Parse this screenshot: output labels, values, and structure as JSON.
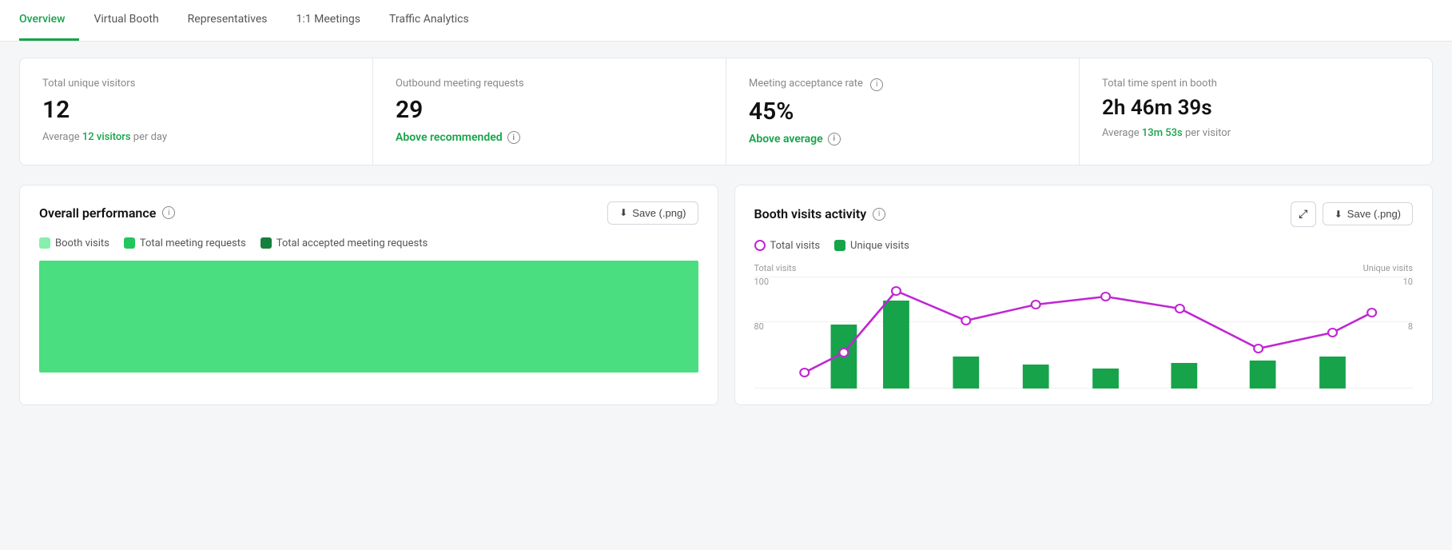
{
  "nav": {
    "items": [
      {
        "label": "Overview",
        "active": true
      },
      {
        "label": "Virtual Booth",
        "active": false
      },
      {
        "label": "Representatives",
        "active": false
      },
      {
        "label": "1:1 Meetings",
        "active": false
      },
      {
        "label": "Traffic Analytics",
        "active": false
      }
    ]
  },
  "stats": [
    {
      "label": "Total unique visitors",
      "value": "12",
      "sub_prefix": "Average ",
      "sub_highlight": "12 visitors",
      "sub_suffix": " per day"
    },
    {
      "label": "Outbound meeting requests",
      "value": "29",
      "badge": "Above recommended",
      "show_info": true
    },
    {
      "label": "Meeting acceptance rate",
      "value": "45%",
      "badge": "Above average",
      "show_info": true
    },
    {
      "label": "Total time spent in booth",
      "value": "2h 46m 39s",
      "sub_prefix": "Average ",
      "sub_highlight": "13m 53s",
      "sub_suffix": " per visitor"
    }
  ],
  "charts": {
    "performance": {
      "title": "Overall performance",
      "save_label": "Save (.png)",
      "legend": [
        {
          "label": "Booth visits",
          "color": "#86efac"
        },
        {
          "label": "Total meeting requests",
          "color": "#22c55e"
        },
        {
          "label": "Total accepted meeting requests",
          "color": "#15803d"
        }
      ]
    },
    "activity": {
      "title": "Booth visits activity",
      "save_label": "Save (.png)",
      "legend": [
        {
          "label": "Total visits",
          "type": "line",
          "color": "#c026d3"
        },
        {
          "label": "Unique visits",
          "color": "#16a34a"
        }
      ],
      "y_left_label": "Total visits",
      "y_right_label": "Unique visits",
      "y_left_max": "100",
      "y_left_80": "80",
      "y_right_max": "10",
      "y_right_8": "8"
    }
  },
  "icons": {
    "download": "⬇",
    "expand": "⤢",
    "info": "i"
  }
}
